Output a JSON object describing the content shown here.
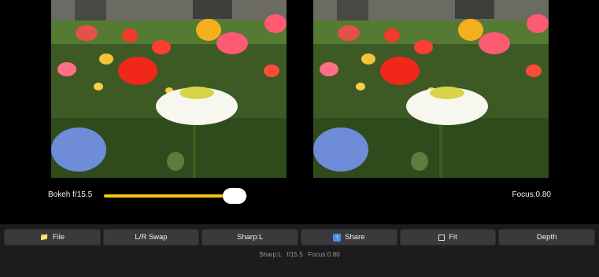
{
  "controls": {
    "bokeh_label": "Bokeh f/15.5",
    "slider_value": 0.91,
    "focus_label": "Focus:0.80"
  },
  "toolbar": {
    "buttons": [
      {
        "label": "File",
        "icon": "folder-icon"
      },
      {
        "label": "L/R Swap",
        "icon": ""
      },
      {
        "label": "Sharp:L",
        "icon": ""
      },
      {
        "label": "Share",
        "icon": "share-icon"
      },
      {
        "label": "Fit",
        "icon": "fit-icon"
      },
      {
        "label": "Depth",
        "icon": ""
      }
    ]
  },
  "status_bar": {
    "sharp": "Sharp:L",
    "aperture": "f/15.5",
    "focus": "Focus:0.80"
  },
  "colors": {
    "accent": "#f5c518",
    "toolbar_bg": "#1c1c1e",
    "button_bg": "#3a3a3c"
  }
}
